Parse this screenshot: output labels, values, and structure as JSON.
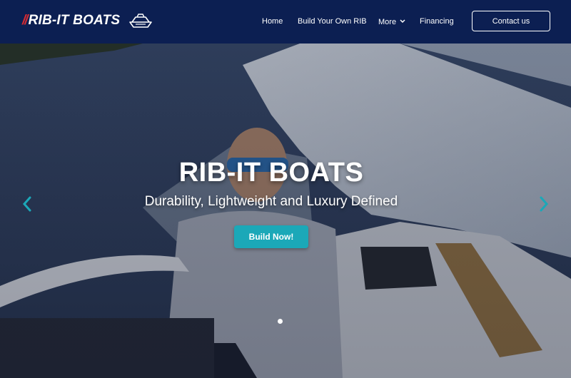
{
  "brand": {
    "slashes": "//",
    "name": "RIB-IT BOATS",
    "accent_color": "#d52b33",
    "logo_icon": "rib-boat-icon"
  },
  "nav": {
    "items": [
      {
        "label": "Home"
      },
      {
        "label": "Build Your Own RIB"
      },
      {
        "label": "More",
        "icon": "chevron-down-icon"
      },
      {
        "label": "Financing"
      }
    ],
    "contact_label": "Contact us"
  },
  "hero": {
    "title": "RIB-IT BOATS",
    "subtitle": "Durability, Lightweight and Luxury Defined",
    "cta_label": "Build Now!",
    "cta_color": "#1ba8b8",
    "prev_icon": "chevron-left-icon",
    "next_icon": "chevron-right-icon",
    "slide_count": 1,
    "active_slide": 1
  },
  "colors": {
    "header_bg": "#0c1f52",
    "arrow": "#1ba8b8"
  }
}
